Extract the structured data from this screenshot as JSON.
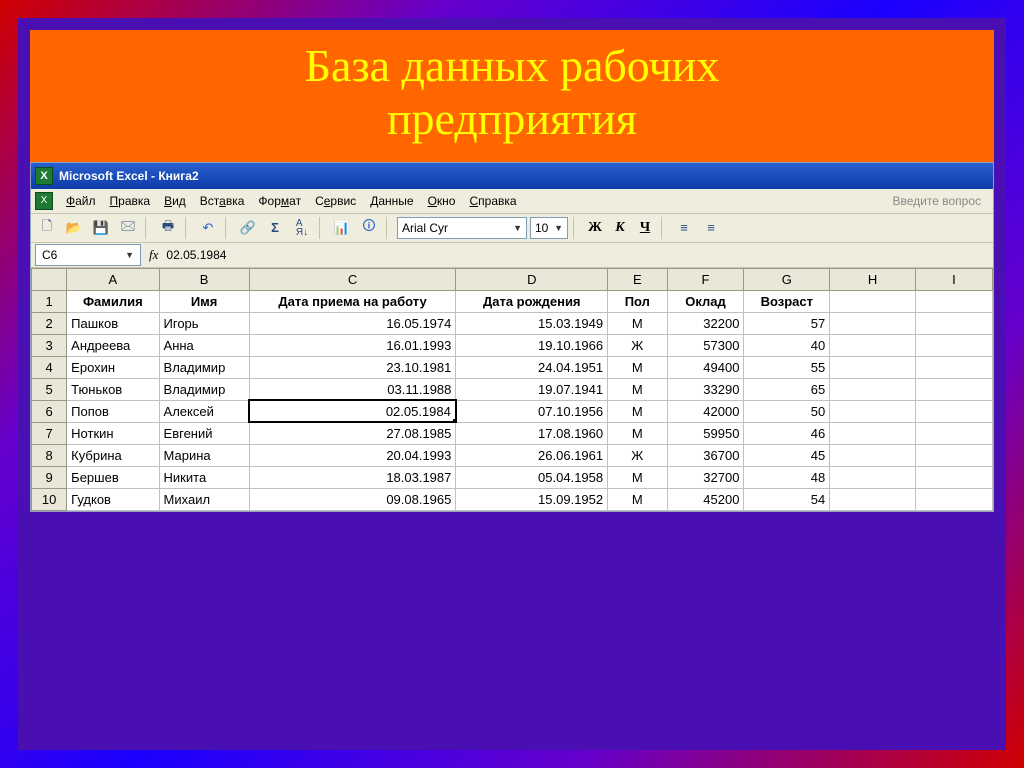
{
  "slide": {
    "title_line1": "База данных рабочих",
    "title_line2": "предприятия"
  },
  "window": {
    "title": "Microsoft Excel - Книга2"
  },
  "menu": {
    "items": [
      "Файл",
      "Правка",
      "Вид",
      "Вставка",
      "Формат",
      "Сервис",
      "Данные",
      "Окно",
      "Справка"
    ],
    "ask_placeholder": "Введите вопрос"
  },
  "toolbar": {
    "font": "Arial Cyr",
    "size": "10"
  },
  "formula_bar": {
    "cell_ref": "C6",
    "fx": "fx",
    "value": "02.05.1984"
  },
  "columns": [
    "A",
    "B",
    "C",
    "D",
    "E",
    "F",
    "G",
    "H",
    "I"
  ],
  "headers": [
    "Фамилия",
    "Имя",
    "Дата приема на работу",
    "Дата рождения",
    "Пол",
    "Оклад",
    "Возраст"
  ],
  "rows": [
    {
      "n": "2",
      "a": "Пашков",
      "b": "Игорь",
      "c": "16.05.1974",
      "d": "15.03.1949",
      "e": "М",
      "f": "32200",
      "g": "57"
    },
    {
      "n": "3",
      "a": "Андреева",
      "b": "Анна",
      "c": "16.01.1993",
      "d": "19.10.1966",
      "e": "Ж",
      "f": "57300",
      "g": "40"
    },
    {
      "n": "4",
      "a": "Ерохин",
      "b": "Владимир",
      "c": "23.10.1981",
      "d": "24.04.1951",
      "e": "М",
      "f": "49400",
      "g": "55"
    },
    {
      "n": "5",
      "a": "Тюньков",
      "b": "Владимир",
      "c": "03.11.1988",
      "d": "19.07.1941",
      "e": "М",
      "f": "33290",
      "g": "65"
    },
    {
      "n": "6",
      "a": "Попов",
      "b": "Алексей",
      "c": "02.05.1984",
      "d": "07.10.1956",
      "e": "М",
      "f": "42000",
      "g": "50"
    },
    {
      "n": "7",
      "a": "Ноткин",
      "b": "Евгений",
      "c": "27.08.1985",
      "d": "17.08.1960",
      "e": "М",
      "f": "59950",
      "g": "46"
    },
    {
      "n": "8",
      "a": "Кубрина",
      "b": "Марина",
      "c": "20.04.1993",
      "d": "26.06.1961",
      "e": "Ж",
      "f": "36700",
      "g": "45"
    },
    {
      "n": "9",
      "a": "Бершев",
      "b": "Никита",
      "c": "18.03.1987",
      "d": "05.04.1958",
      "e": "М",
      "f": "32700",
      "g": "48"
    },
    {
      "n": "10",
      "a": "Гудков",
      "b": "Михаил",
      "c": "09.08.1965",
      "d": "15.09.1952",
      "e": "М",
      "f": "45200",
      "g": "54"
    }
  ],
  "active_cell": "C6"
}
